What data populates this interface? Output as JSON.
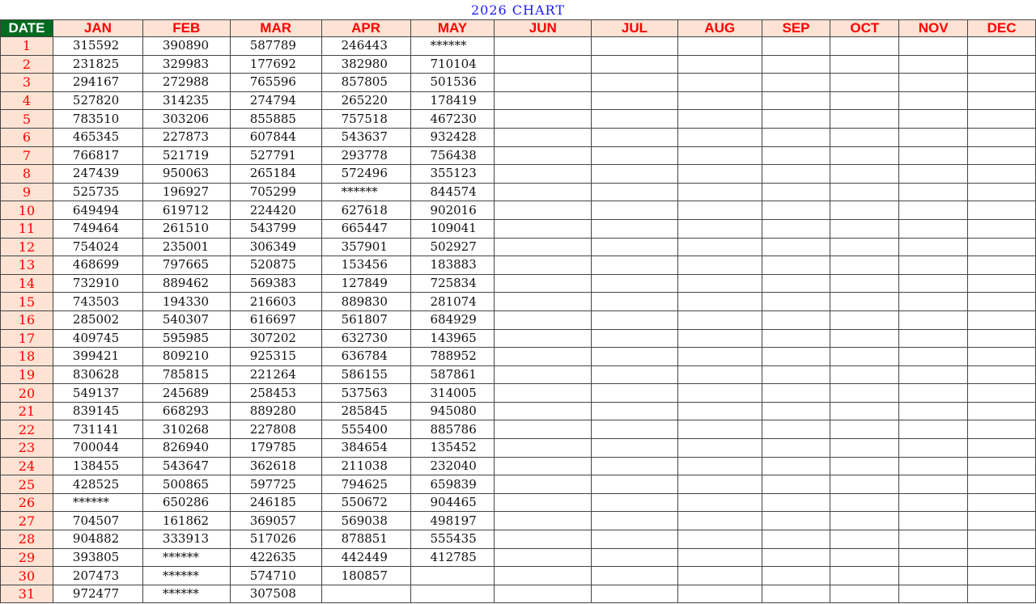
{
  "title": "2026 CHART",
  "colors": {
    "header_bg": "#fde3d4",
    "header_text": "#ff0000",
    "date_header_bg": "#006b1f",
    "title_text": "#1a1aff"
  },
  "date_header": "DATE",
  "months": [
    "JAN",
    "FEB",
    "MAR",
    "APR",
    "MAY",
    "JUN",
    "JUL",
    "AUG",
    "SEP",
    "OCT",
    "NOV",
    "DEC"
  ],
  "rows": [
    {
      "date": "1",
      "values": [
        "315592",
        "390890",
        "587789",
        "246443",
        "******"
      ]
    },
    {
      "date": "2",
      "values": [
        "231825",
        "329983",
        "177692",
        "382980",
        "710104"
      ]
    },
    {
      "date": "3",
      "values": [
        "294167",
        "272988",
        "765596",
        "857805",
        "501536"
      ]
    },
    {
      "date": "4",
      "values": [
        "527820",
        "314235",
        "274794",
        "265220",
        "178419"
      ]
    },
    {
      "date": "5",
      "values": [
        "783510",
        "303206",
        "855885",
        "757518",
        "467230"
      ]
    },
    {
      "date": "6",
      "values": [
        "465345",
        "227873",
        "607844",
        "543637",
        "932428"
      ]
    },
    {
      "date": "7",
      "values": [
        "766817",
        "521719",
        "527791",
        "293778",
        "756438"
      ]
    },
    {
      "date": "8",
      "values": [
        "247439",
        "950063",
        "265184",
        "572496",
        "355123"
      ]
    },
    {
      "date": "9",
      "values": [
        "525735",
        "196927",
        "705299",
        "******",
        "844574"
      ]
    },
    {
      "date": "10",
      "values": [
        "649494",
        "619712",
        "224420",
        "627618",
        "902016"
      ]
    },
    {
      "date": "11",
      "values": [
        "749464",
        "261510",
        "543799",
        "665447",
        "109041"
      ]
    },
    {
      "date": "12",
      "values": [
        "754024",
        "235001",
        "306349",
        "357901",
        "502927"
      ]
    },
    {
      "date": "13",
      "values": [
        "468699",
        "797665",
        "520875",
        "153456",
        "183883"
      ]
    },
    {
      "date": "14",
      "values": [
        "732910",
        "889462",
        "569383",
        "127849",
        "725834"
      ]
    },
    {
      "date": "15",
      "values": [
        "743503",
        "194330",
        "216603",
        "889830",
        "281074"
      ]
    },
    {
      "date": "16",
      "values": [
        "285002",
        "540307",
        "616697",
        "561807",
        "684929"
      ]
    },
    {
      "date": "17",
      "values": [
        "409745",
        "595985",
        "307202",
        "632730",
        "143965"
      ]
    },
    {
      "date": "18",
      "values": [
        "399421",
        "809210",
        "925315",
        "636784",
        "788952"
      ]
    },
    {
      "date": "19",
      "values": [
        "830628",
        "785815",
        "221264",
        "586155",
        "587861"
      ]
    },
    {
      "date": "20",
      "values": [
        "549137",
        "245689",
        "258453",
        "537563",
        "314005"
      ]
    },
    {
      "date": "21",
      "values": [
        "839145",
        "668293",
        "889280",
        "285845",
        "945080"
      ]
    },
    {
      "date": "22",
      "values": [
        "731141",
        "310268",
        "227808",
        "555400",
        "885786"
      ]
    },
    {
      "date": "23",
      "values": [
        "700044",
        "826940",
        "179785",
        "384654",
        "135452"
      ]
    },
    {
      "date": "24",
      "values": [
        "138455",
        "543647",
        "362618",
        "211038",
        "232040"
      ]
    },
    {
      "date": "25",
      "values": [
        "428525",
        "500865",
        "597725",
        "794625",
        "659839"
      ]
    },
    {
      "date": "26",
      "values": [
        "******",
        "650286",
        "246185",
        "550672",
        "904465"
      ]
    },
    {
      "date": "27",
      "values": [
        "704507",
        "161862",
        "369057",
        "569038",
        "498197"
      ]
    },
    {
      "date": "28",
      "values": [
        "904882",
        "333913",
        "517026",
        "878851",
        "555435"
      ]
    },
    {
      "date": "29",
      "values": [
        "393805",
        "******",
        "422635",
        "442449",
        "412785"
      ]
    },
    {
      "date": "30",
      "values": [
        "207473",
        "******",
        "574710",
        "180857",
        ""
      ]
    },
    {
      "date": "31",
      "values": [
        "972477",
        "******",
        "307508",
        "",
        ""
      ]
    }
  ]
}
